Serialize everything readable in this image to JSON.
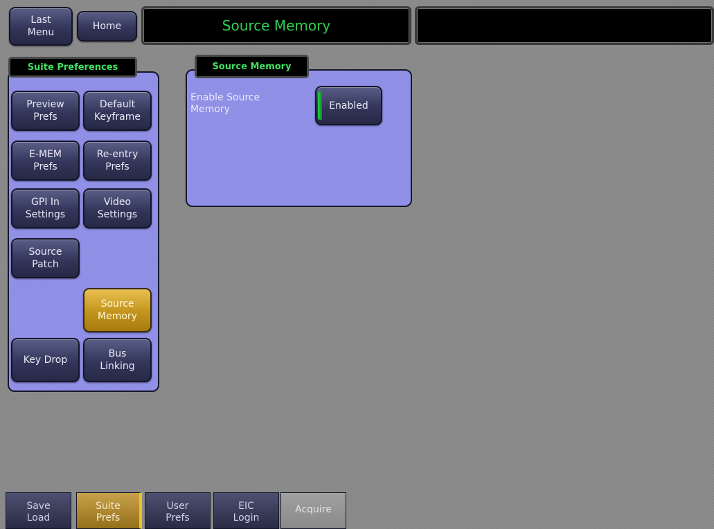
{
  "header": {
    "last_menu_label": "Last\nMenu",
    "home_label": "Home",
    "title": "Source Memory",
    "status_text": ""
  },
  "suite_preferences": {
    "title": "Suite Preferences",
    "buttons": [
      {
        "label": "Preview\nPrefs",
        "selected": false
      },
      {
        "label": "Default\nKeyframe",
        "selected": false
      },
      {
        "label": "E-MEM\nPrefs",
        "selected": false
      },
      {
        "label": "Re-entry\nPrefs",
        "selected": false
      },
      {
        "label": "GPI In\nSettings",
        "selected": false
      },
      {
        "label": "Video\nSettings",
        "selected": false
      },
      {
        "label": "Source\nPatch",
        "selected": false
      },
      {
        "label": "Source\nMemory",
        "selected": true
      },
      {
        "label": "Key Drop",
        "selected": false
      },
      {
        "label": "Bus\nLinking",
        "selected": false
      }
    ]
  },
  "source_memory": {
    "title": "Source Memory",
    "enable_label": "Enable Source\nMemory",
    "toggle_value": "Enabled",
    "toggle_on": true
  },
  "bottom_tabs": [
    {
      "label": "Save\nLoad",
      "selected": false
    },
    {
      "label": "Suite\nPrefs",
      "selected": true
    },
    {
      "label": "User\nPrefs",
      "selected": false
    },
    {
      "label": "EIC\nLogin",
      "selected": false
    },
    {
      "label": "Acquire",
      "selected": false,
      "disabled": true
    }
  ],
  "colors": {
    "panel": "#8e8ee6",
    "selected": "#c3941c",
    "title_text": "#40e060",
    "toggle_indicator": "#2ad045"
  }
}
